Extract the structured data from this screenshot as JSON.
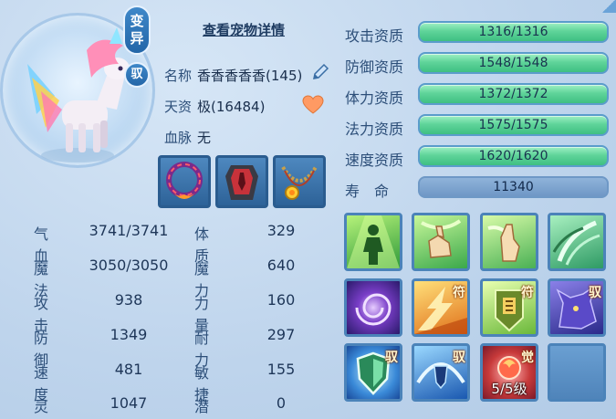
{
  "badges": {
    "mutant": "变异",
    "tame": "驭"
  },
  "detail_link": "查看宠物详情",
  "info": {
    "name_label": "名称",
    "name_value": "香香香香香(145)",
    "aptitude_label": "天资",
    "aptitude_value": "极(16484)",
    "bloodline_label": "血脉",
    "bloodline_value": "无"
  },
  "stats": [
    {
      "label": "气血",
      "value": "3741/3741"
    },
    {
      "label": "体质",
      "value": "329"
    },
    {
      "label": "魔法",
      "value": "3050/3050"
    },
    {
      "label": "魔力",
      "value": "640"
    },
    {
      "label": "攻击",
      "value": "938"
    },
    {
      "label": "力量",
      "value": "160"
    },
    {
      "label": "防御",
      "value": "1349"
    },
    {
      "label": "耐力",
      "value": "297"
    },
    {
      "label": "速度",
      "value": "481"
    },
    {
      "label": "敏捷",
      "value": "155"
    },
    {
      "label": "灵力",
      "value": "1047"
    },
    {
      "label": "潜力",
      "value": "0"
    }
  ],
  "aptitudes": [
    {
      "label": "攻击资质",
      "value": "1316/1316"
    },
    {
      "label": "防御资质",
      "value": "1548/1548"
    },
    {
      "label": "体力资质",
      "value": "1372/1372"
    },
    {
      "label": "法力资质",
      "value": "1575/1575"
    },
    {
      "label": "速度资质",
      "value": "1620/1620"
    }
  ],
  "life": {
    "label": "寿　命",
    "value": "11340"
  },
  "skill_tags": {
    "s6": "符",
    "s7": "符",
    "s8": "驭",
    "s9": "驭",
    "s10": "驭",
    "s11": "觉"
  },
  "skill_level": "5/5级",
  "colors": {
    "apt_bar": "#5fd49a",
    "panel": "#bed4ec",
    "frame": "#2a5c8f"
  }
}
